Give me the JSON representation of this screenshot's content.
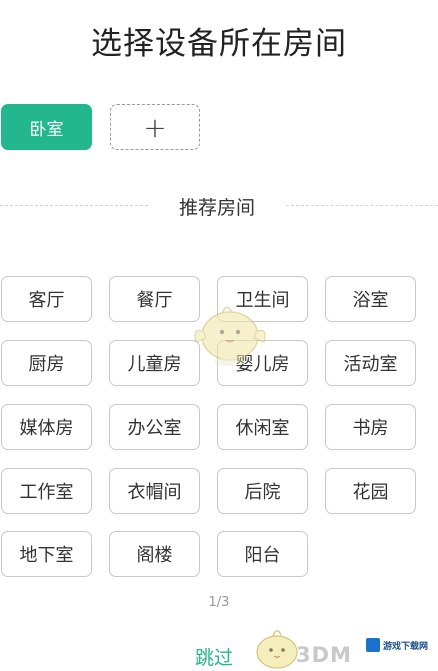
{
  "header": {
    "title": "选择设备所在房间"
  },
  "selected": {
    "room_label": "卧室",
    "add_label": "+"
  },
  "recommend": {
    "section_title": "推荐房间"
  },
  "rooms": [
    "客厅",
    "餐厅",
    "卫生间",
    "浴室",
    "厨房",
    "儿童房",
    "婴儿房",
    "活动室",
    "媒体房",
    "办公室",
    "休闲室",
    "书房",
    "工作室",
    "衣帽间",
    "后院",
    "花园",
    "地下室",
    "阁楼",
    "阳台"
  ],
  "pager": {
    "text": "1/3"
  },
  "footer": {
    "skip_label": "跳过",
    "watermark_text": "3DM",
    "site_text": "游戏下载网"
  },
  "colors": {
    "accent": "#22b78d",
    "chip_border": "#c9c9c9"
  }
}
